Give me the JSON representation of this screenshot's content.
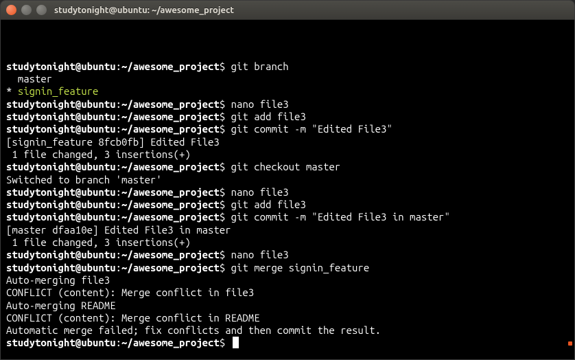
{
  "window": {
    "title": "studytonight@ubuntu: ~/awesome_project"
  },
  "prompt": {
    "user": "studytonight@ubuntu",
    "sep1": ":",
    "path": "~/awesome_project",
    "sym": "$"
  },
  "session": [
    {
      "type": "cmd",
      "text": "git branch"
    },
    {
      "type": "out",
      "text": "  master"
    },
    {
      "type": "out-current-branch",
      "prefix": "* ",
      "text": "signin_feature"
    },
    {
      "type": "cmd",
      "text": "nano file3"
    },
    {
      "type": "cmd",
      "text": "git add file3"
    },
    {
      "type": "cmd",
      "text": "git commit -m \"Edited File3\""
    },
    {
      "type": "out",
      "text": "[signin_feature 8fcb0fb] Edited File3"
    },
    {
      "type": "out",
      "text": " 1 file changed, 3 insertions(+)"
    },
    {
      "type": "cmd",
      "text": "git checkout master"
    },
    {
      "type": "out",
      "text": "Switched to branch 'master'"
    },
    {
      "type": "cmd",
      "text": "nano file3"
    },
    {
      "type": "cmd",
      "text": "git add file3"
    },
    {
      "type": "cmd",
      "text": "git commit -m \"Edited File3 in master\""
    },
    {
      "type": "out",
      "text": "[master dfaa10e] Edited File3 in master"
    },
    {
      "type": "out",
      "text": " 1 file changed, 3 insertions(+)"
    },
    {
      "type": "cmd",
      "text": "nano file3"
    },
    {
      "type": "cmd",
      "text": "git merge signin_feature"
    },
    {
      "type": "out",
      "text": "Auto-merging file3"
    },
    {
      "type": "out",
      "text": "CONFLICT (content): Merge conflict in file3"
    },
    {
      "type": "out",
      "text": "Auto-merging README"
    },
    {
      "type": "out",
      "text": "CONFLICT (content): Merge conflict in README"
    },
    {
      "type": "out",
      "text": "Automatic merge failed; fix conflicts and then commit the result."
    },
    {
      "type": "cmd-cursor",
      "text": ""
    }
  ]
}
